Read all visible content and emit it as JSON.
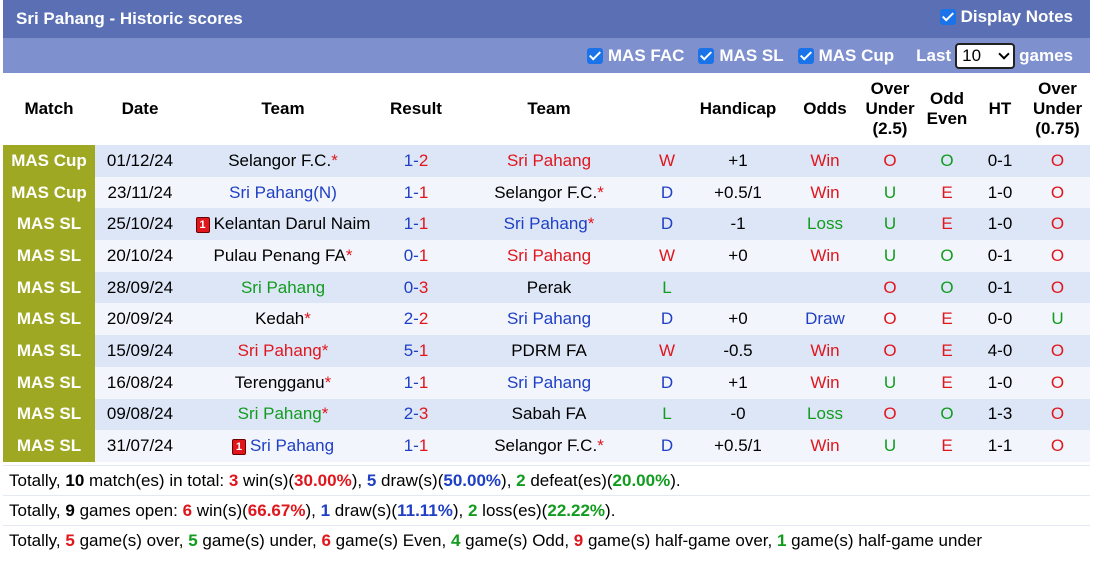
{
  "header": {
    "title": "Sri Pahang - Historic scores",
    "display_notes": "Display Notes"
  },
  "filters": {
    "fac": "MAS FAC",
    "sl": "MAS SL",
    "cup": "MAS Cup",
    "last_label": "Last",
    "last_value": "10",
    "games_label": "games"
  },
  "columns": {
    "match": "Match",
    "date": "Date",
    "team1": "Team",
    "result": "Result",
    "team2": "Team",
    "handicap": "Handicap",
    "odds": "Odds",
    "ou_line1": "Over",
    "ou_line2": "Under",
    "ou_line3": "(2.5)",
    "oe_line1": "Odd",
    "oe_line2": "Even",
    "ht": "HT",
    "hou_line1": "Over",
    "hou_line2": "Under",
    "hou_line3": "(0.75)"
  },
  "rows": [
    {
      "match": "MAS Cup",
      "date": "01/12/24",
      "team1": "Selangor F.C.",
      "team1_color": "black",
      "team1_star": "*",
      "team1_card": "",
      "team1_suffix": "",
      "score_home": "1",
      "score_away": "2",
      "team2": "Sri Pahang",
      "team2_color": "red",
      "team2_star": "",
      "wdl": "W",
      "handicap": "+1",
      "odds": "Win",
      "ou": "O",
      "oe": "O",
      "ht": "0-1",
      "hou": "O"
    },
    {
      "match": "MAS Cup",
      "date": "23/11/24",
      "team1": "Sri Pahang",
      "team1_color": "blue",
      "team1_star": "",
      "team1_card": "",
      "team1_suffix": "(N)",
      "score_home": "1",
      "score_away": "1",
      "team2": "Selangor F.C.",
      "team2_color": "black",
      "team2_star": "*",
      "wdl": "D",
      "handicap": "+0.5/1",
      "odds": "Win",
      "ou": "U",
      "oe": "E",
      "ht": "1-0",
      "hou": "O"
    },
    {
      "match": "MAS SL",
      "date": "25/10/24",
      "team1": "Kelantan Darul Naim",
      "team1_color": "black",
      "team1_star": "",
      "team1_card": "1",
      "team1_suffix": "",
      "score_home": "1",
      "score_away": "1",
      "team2": "Sri Pahang",
      "team2_color": "blue",
      "team2_star": "*",
      "wdl": "D",
      "handicap": "-1",
      "odds": "Loss",
      "ou": "U",
      "oe": "E",
      "ht": "1-0",
      "hou": "O"
    },
    {
      "match": "MAS SL",
      "date": "20/10/24",
      "team1": "Pulau Penang FA",
      "team1_color": "black",
      "team1_star": "*",
      "team1_card": "",
      "team1_suffix": "",
      "score_home": "0",
      "score_away": "1",
      "team2": "Sri Pahang",
      "team2_color": "red",
      "team2_star": "",
      "wdl": "W",
      "handicap": "+0",
      "odds": "Win",
      "ou": "U",
      "oe": "O",
      "ht": "0-1",
      "hou": "O"
    },
    {
      "match": "MAS SL",
      "date": "28/09/24",
      "team1": "Sri Pahang",
      "team1_color": "green",
      "team1_star": "",
      "team1_card": "",
      "team1_suffix": "",
      "score_home": "0",
      "score_away": "3",
      "team2": "Perak",
      "team2_color": "black",
      "team2_star": "",
      "wdl": "L",
      "handicap": "",
      "odds": "",
      "ou": "O",
      "oe": "O",
      "ht": "0-1",
      "hou": "O"
    },
    {
      "match": "MAS SL",
      "date": "20/09/24",
      "team1": "Kedah",
      "team1_color": "black",
      "team1_star": "*",
      "team1_card": "",
      "team1_suffix": "",
      "score_home": "2",
      "score_away": "2",
      "team2": "Sri Pahang",
      "team2_color": "blue",
      "team2_star": "",
      "wdl": "D",
      "handicap": "+0",
      "odds": "Draw",
      "ou": "O",
      "oe": "E",
      "ht": "0-0",
      "hou": "U"
    },
    {
      "match": "MAS SL",
      "date": "15/09/24",
      "team1": "Sri Pahang",
      "team1_color": "red",
      "team1_star": "*",
      "team1_card": "",
      "team1_suffix": "",
      "score_home": "5",
      "score_away": "1",
      "team2": "PDRM FA",
      "team2_color": "black",
      "team2_star": "",
      "wdl": "W",
      "handicap": "-0.5",
      "odds": "Win",
      "ou": "O",
      "oe": "E",
      "ht": "4-0",
      "hou": "O"
    },
    {
      "match": "MAS SL",
      "date": "16/08/24",
      "team1": "Terengganu",
      "team1_color": "black",
      "team1_star": "*",
      "team1_card": "",
      "team1_suffix": "",
      "score_home": "1",
      "score_away": "1",
      "team2": "Sri Pahang",
      "team2_color": "blue",
      "team2_star": "",
      "wdl": "D",
      "handicap": "+1",
      "odds": "Win",
      "ou": "U",
      "oe": "E",
      "ht": "1-0",
      "hou": "O"
    },
    {
      "match": "MAS SL",
      "date": "09/08/24",
      "team1": "Sri Pahang",
      "team1_color": "green",
      "team1_star": "*",
      "team1_card": "",
      "team1_suffix": "",
      "score_home": "2",
      "score_away": "3",
      "team2": "Sabah FA",
      "team2_color": "black",
      "team2_star": "",
      "wdl": "L",
      "handicap": "-0",
      "odds": "Loss",
      "ou": "O",
      "oe": "O",
      "ht": "1-3",
      "hou": "O"
    },
    {
      "match": "MAS SL",
      "date": "31/07/24",
      "team1": "Sri Pahang",
      "team1_color": "blue",
      "team1_star": "",
      "team1_card": "1",
      "team1_suffix": "",
      "score_home": "1",
      "score_away": "1",
      "team2": "Selangor F.C.",
      "team2_color": "black",
      "team2_star": "*",
      "wdl": "D",
      "handicap": "+0.5/1",
      "odds": "Win",
      "ou": "U",
      "oe": "E",
      "ht": "1-1",
      "hou": "O"
    }
  ],
  "summary": {
    "line1": {
      "p1": "Totally, ",
      "matches": "10",
      "p2": " match(es) in total: ",
      "wins": "3",
      "p3": " win(s)(",
      "win_pct": "30.00%",
      "p4": "), ",
      "draws": "5",
      "p5": " draw(s)(",
      "draw_pct": "50.00%",
      "p6": "), ",
      "defeats": "2",
      "p7": " defeat(es)(",
      "defeat_pct": "20.00%",
      "p8": ")."
    },
    "line2": {
      "p1": "Totally, ",
      "games": "9",
      "p2": " games open: ",
      "wins": "6",
      "p3": " win(s)(",
      "win_pct": "66.67%",
      "p4": "), ",
      "draws": "1",
      "p5": " draw(s)(",
      "draw_pct": "11.11%",
      "p6": "), ",
      "losses": "2",
      "p7": " loss(es)(",
      "loss_pct": "22.22%",
      "p8": ")."
    },
    "line3": {
      "p1": "Totally, ",
      "over": "5",
      "p2": " game(s) over, ",
      "under": "5",
      "p3": " game(s) under, ",
      "even": "6",
      "p4": " game(s) Even, ",
      "odd": "4",
      "p5": " game(s) Odd, ",
      "half_over": "9",
      "p6": " game(s) half-game over, ",
      "half_under": "1",
      "p7": " game(s) half-game under"
    }
  },
  "colors": {
    "title_bar": "#5a6fb4",
    "filter_bar": "#7f90cf",
    "match_cell": "#9ea823",
    "row_a": "#dde6f7",
    "row_b": "#f2f5fc",
    "win_red": "#e0161d",
    "draw_blue": "#1f3fc4",
    "loss_green": "#129c1f"
  }
}
